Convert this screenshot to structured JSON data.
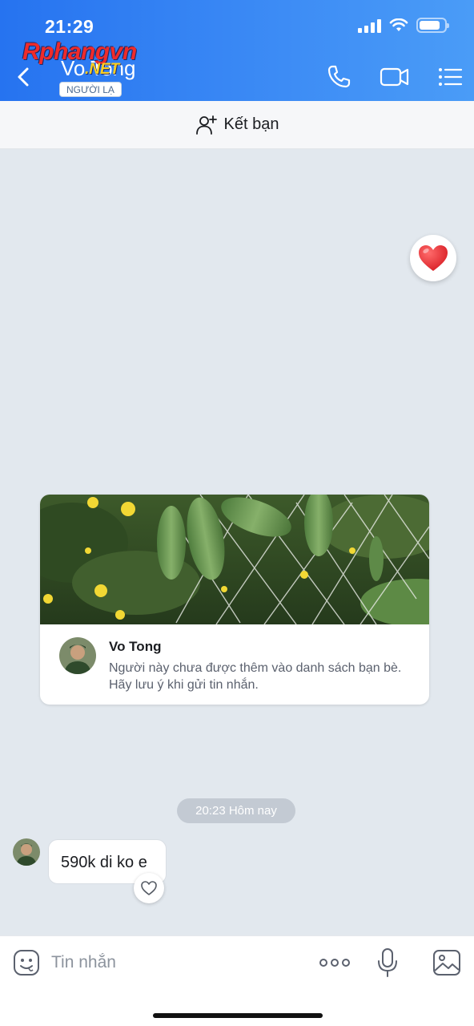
{
  "status_bar": {
    "time": "21:29"
  },
  "header": {
    "contact_name": "Vo Tong",
    "badge": "NGƯỜI LẠ",
    "watermark_main": "Rphangvn",
    "watermark_sub": ".NET",
    "icons": [
      "back-icon",
      "phone-icon",
      "video-call-icon",
      "menu-icon"
    ],
    "background": "#2d7ef2"
  },
  "friend_bar": {
    "label": "Kết bạn",
    "icon": "add-user-icon"
  },
  "reaction": {
    "icon": "heart-icon",
    "color": "#e8252c"
  },
  "card": {
    "name": "Vo Tong",
    "description": "Người này chưa được thêm vào danh sách bạn bè. Hãy lưu ý khi gửi tin nhắn."
  },
  "timestamp": "20:23 Hôm nay",
  "messages": [
    {
      "text": "590k di ko e",
      "sender": "Vo Tong"
    }
  ],
  "input": {
    "placeholder": "Tin nhắn",
    "icons": [
      "sticker-icon",
      "more-icon",
      "microphone-icon",
      "image-icon"
    ]
  }
}
